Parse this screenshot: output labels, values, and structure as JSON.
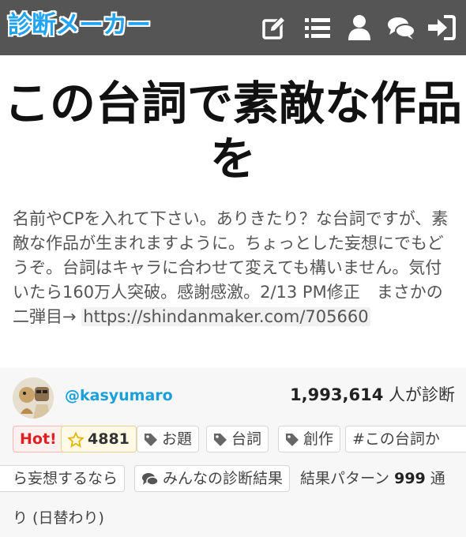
{
  "header": {
    "logo": "診断メーカー",
    "icons": [
      "edit-icon",
      "list-icon",
      "user-icon",
      "comments-icon",
      "sign-in-icon"
    ]
  },
  "title": "この台詞で素敵な作品を",
  "description": {
    "text": "名前やCPを入れて下さい。ありきたり？な台詞ですが、素敵な作品が生まれますように。ちょっとした妄想にでもどうぞ。台詞はキャラに合わせて変えても構いません。気付いたら160万人突破。感謝感激。2/13 PM修正　まさかの二弾目→ ",
    "link": "https://shindanmaker.com/705660"
  },
  "author": {
    "username": "@kasyumaro",
    "count": "1,993,614",
    "count_suffix": " 人が診断"
  },
  "tags": {
    "hot": "Hot!",
    "favorites": "4881",
    "tag1": "お題",
    "tag2": "台詞",
    "tag3": "創作",
    "hashtag_part1": "#この台詞か",
    "hashtag_part2": "ら妄想するなら",
    "results": "みんなの診断結果",
    "pattern_prefix": "結果パターン ",
    "pattern_count": "999",
    "pattern_suffix1": " 通",
    "pattern_suffix2": "り (日替わり)"
  },
  "colors": {
    "header_bg": "#555555",
    "logo": "#23a4f0",
    "username": "#1a9fd9",
    "hot": "#e02020",
    "star": "#e7b400"
  }
}
